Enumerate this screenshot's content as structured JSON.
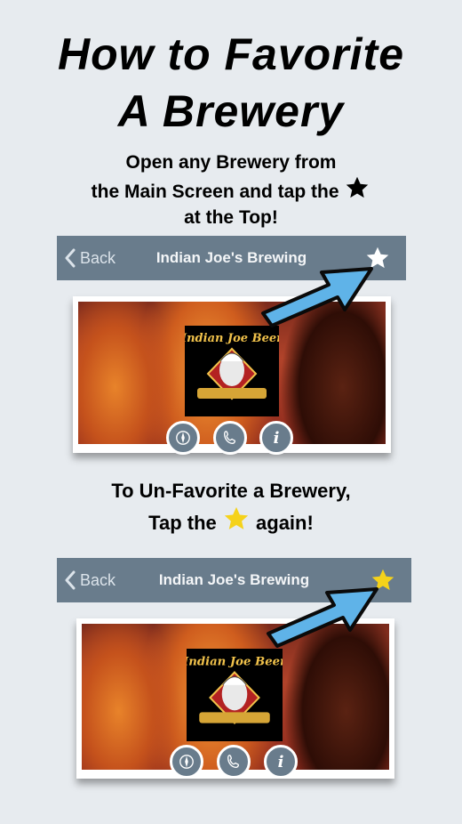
{
  "heading": {
    "line1": "How to Favorite",
    "line2": "A Brewery"
  },
  "instructions": {
    "step1_line1": "Open any Brewery from",
    "step1_line2": "the Main Screen and tap the",
    "step1_line3": "at the Top!",
    "step2_line1": "To Un-Favorite a Brewery,",
    "step2_line2_a": "Tap the",
    "step2_line2_b": "again!"
  },
  "screen1": {
    "back_label": "Back",
    "title": "Indian Joe's Brewing",
    "star_state": "unfavorited",
    "star_color": "#ffffff"
  },
  "screen2": {
    "back_label": "Back",
    "title": "Indian Joe's Brewing",
    "star_state": "favorited",
    "star_color": "#f5d21a"
  },
  "logo_text": "Indian Joe Beer",
  "icons": [
    "compass-icon",
    "phone-icon",
    "info-icon",
    "star-icon",
    "chevron-left-icon",
    "arrow-pointer"
  ],
  "colors": {
    "navbar": "#697c8c",
    "background": "#e7ebef",
    "arrow": "#5fb3e8",
    "gold_star": "#f5d21a"
  }
}
